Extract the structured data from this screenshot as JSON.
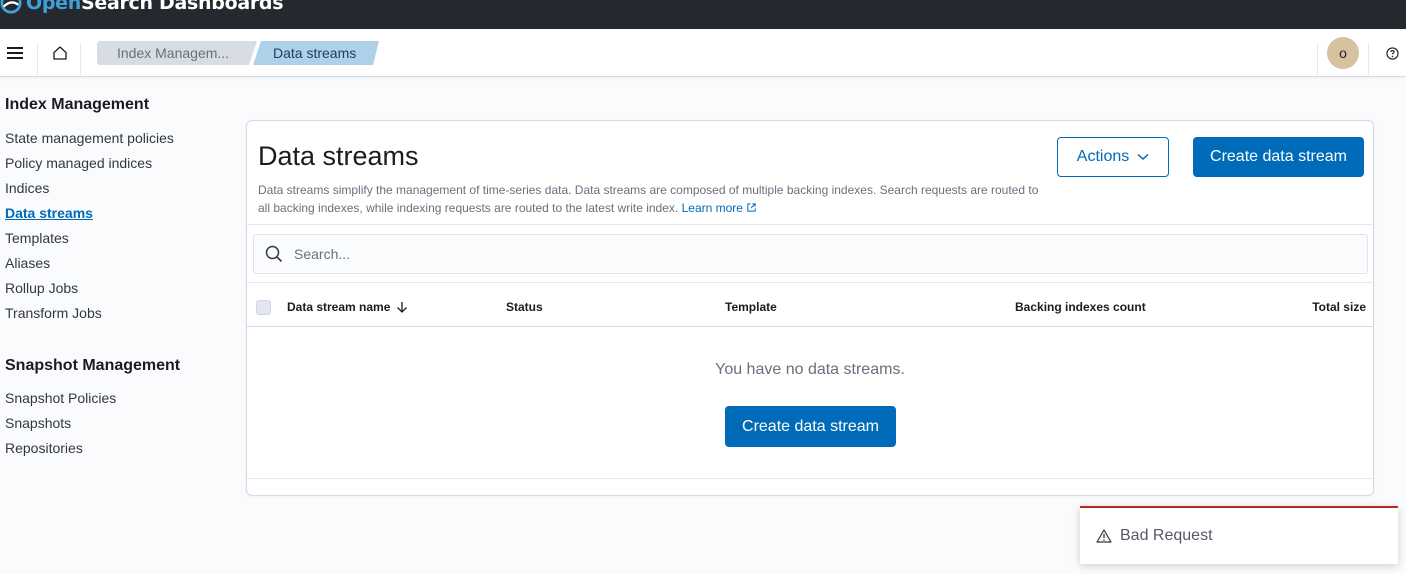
{
  "app": {
    "brand_prefix": "Open",
    "brand_suffix": "Search Dashboards"
  },
  "header": {
    "breadcrumbs": [
      {
        "label": "Index Managem..."
      },
      {
        "label": "Data streams"
      }
    ],
    "avatar_initial": "o"
  },
  "sidebar": {
    "groups": [
      {
        "title": "Index Management",
        "items": [
          {
            "label": "State management policies"
          },
          {
            "label": "Policy managed indices"
          },
          {
            "label": "Indices"
          },
          {
            "label": "Data streams",
            "active": true
          },
          {
            "label": "Templates"
          },
          {
            "label": "Aliases"
          },
          {
            "label": "Rollup Jobs"
          },
          {
            "label": "Transform Jobs"
          }
        ]
      },
      {
        "title": "Snapshot Management",
        "items": [
          {
            "label": "Snapshot Policies"
          },
          {
            "label": "Snapshots"
          },
          {
            "label": "Repositories"
          }
        ]
      }
    ]
  },
  "main": {
    "title": "Data streams",
    "description": "Data streams simplify the management of time-series data. Data streams are composed of multiple backing indexes. Search requests are routed to all backing indexes, while indexing requests are routed to the latest write index.",
    "learn_more": "Learn more",
    "actions_label": "Actions",
    "create_label": "Create data stream",
    "search_placeholder": "Search...",
    "columns": {
      "name": "Data stream name",
      "status": "Status",
      "template": "Template",
      "backing": "Backing indexes count",
      "total": "Total size"
    },
    "empty_message": "You have no data streams.",
    "empty_create_label": "Create data stream"
  },
  "toast": {
    "message": "Bad Request"
  },
  "colors": {
    "accent": "#006bb8",
    "danger": "#bd271e",
    "topbar": "#25282f"
  }
}
